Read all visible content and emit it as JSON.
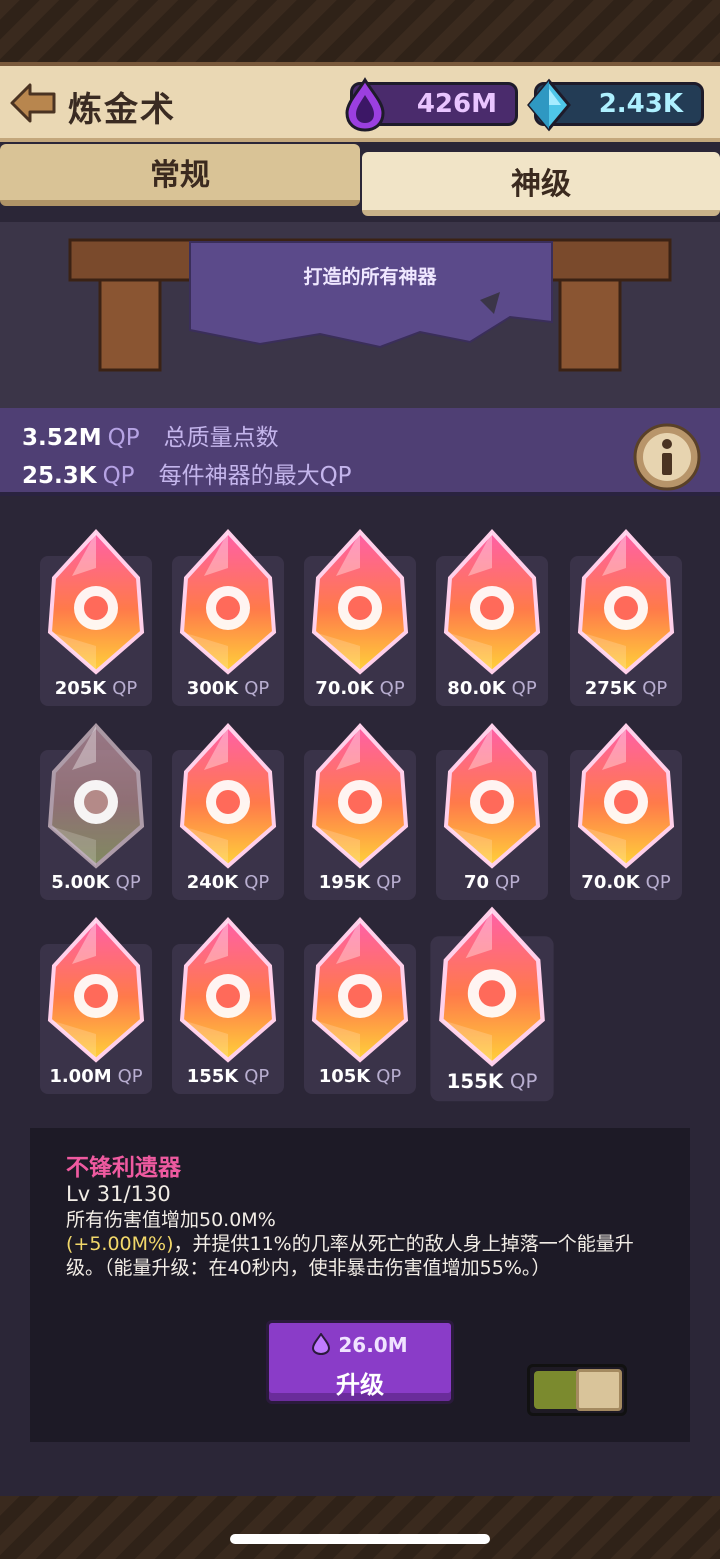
{
  "header": {
    "title": "炼金术",
    "essence": "426M",
    "gems": "2.43K"
  },
  "tabs": [
    {
      "label": "常规",
      "active": false
    },
    {
      "label": "神级",
      "active": true
    }
  ],
  "banner": {
    "text": "打造的所有神器"
  },
  "stats": {
    "total_value": "3.52M",
    "total_unit": "QP",
    "total_label": "总质量点数",
    "max_value": "25.3K",
    "max_unit": "QP",
    "max_label": "每件神器的最大QP"
  },
  "artifacts": [
    {
      "qp": "205K",
      "unit": "QP",
      "icon": "flying-creature-icon",
      "faded": false
    },
    {
      "qp": "300K",
      "unit": "QP",
      "icon": "arrow-up-icon",
      "faded": false
    },
    {
      "qp": "70.0K",
      "unit": "QP",
      "icon": "hourglass-ring-icon",
      "faded": false
    },
    {
      "qp": "80.0K",
      "unit": "QP",
      "icon": "heart-cross-icon",
      "faded": false
    },
    {
      "qp": "275K",
      "unit": "QP",
      "icon": "heart-hand-icon",
      "faded": false
    },
    {
      "qp": "5.00K",
      "unit": "QP",
      "icon": "pointing-hand-icon",
      "faded": true
    },
    {
      "qp": "240K",
      "unit": "QP",
      "icon": "sword-icon",
      "faded": false
    },
    {
      "qp": "195K",
      "unit": "QP",
      "icon": "coins-icon",
      "faded": false
    },
    {
      "qp": "70",
      "unit": "QP",
      "icon": "cracked-rock-icon",
      "faded": false
    },
    {
      "qp": "70.0K",
      "unit": "QP",
      "icon": "portal-runner-icon",
      "faded": false
    },
    {
      "qp": "1.00M",
      "unit": "QP",
      "icon": "sparkle-icon",
      "faded": false
    },
    {
      "qp": "155K",
      "unit": "QP",
      "icon": "hourglass-paw-icon",
      "faded": false
    },
    {
      "qp": "105K",
      "unit": "QP",
      "icon": "hourglass-skull-icon",
      "faded": false
    },
    {
      "qp": "155K",
      "unit": "QP",
      "icon": "hourglass-sword-icon",
      "faded": false,
      "selected": true
    }
  ],
  "detail": {
    "name": "不锋利遗器",
    "level": "Lv 31/130",
    "line1": "所有伤害值增加50.0M%",
    "highlight": "(+5.00M%)",
    "line2": "，并提供11%的几率从死亡的敌人身上掉落一个能量升级。（能量升级：在40秒内，使非暴击伤害值增加55%。）",
    "upgrade_cost": "26.0M",
    "upgrade_label": "升级"
  },
  "colors": {
    "header_bg": "#ead8b4",
    "stats_bg": "#4f3f74",
    "name_pink": "#ef5aa0",
    "highlight_yellow": "#f2d86a",
    "button_purple": "#8a3cc8"
  }
}
